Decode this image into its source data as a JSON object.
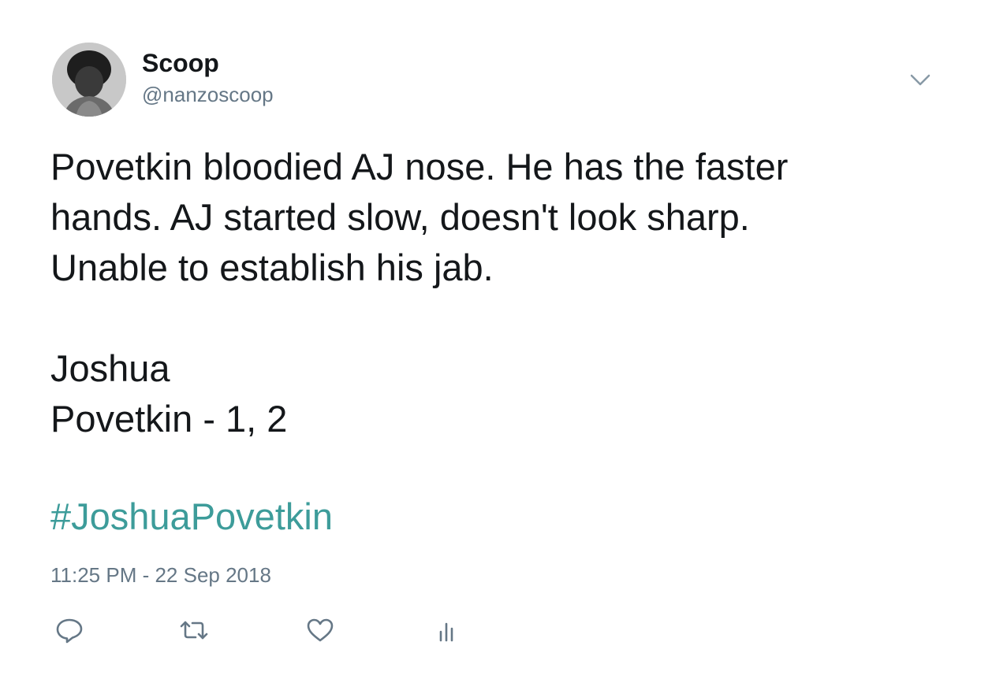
{
  "tweet": {
    "author": {
      "display_name": "Scoop",
      "handle": "@nanzoscoop"
    },
    "text_lines": [
      "Povetkin bloodied AJ nose. He has the faster",
      "hands. AJ started slow, doesn't look sharp.",
      "Unable to establish his jab."
    ],
    "score_lines": [
      "Joshua",
      "Povetkin - 1, 2"
    ],
    "hashtag": "#JoshuaPovetkin",
    "timestamp": "11:25 PM - 22 Sep 2018",
    "actions": {
      "reply_icon": "reply-icon",
      "retweet_icon": "retweet-icon",
      "like_icon": "heart-icon",
      "analytics_icon": "analytics-icon"
    },
    "menu_icon": "chevron-down-icon"
  },
  "colors": {
    "text": "#14171a",
    "secondary": "#657786",
    "hashtag": "#3d9c9a",
    "icon": "#657786"
  }
}
